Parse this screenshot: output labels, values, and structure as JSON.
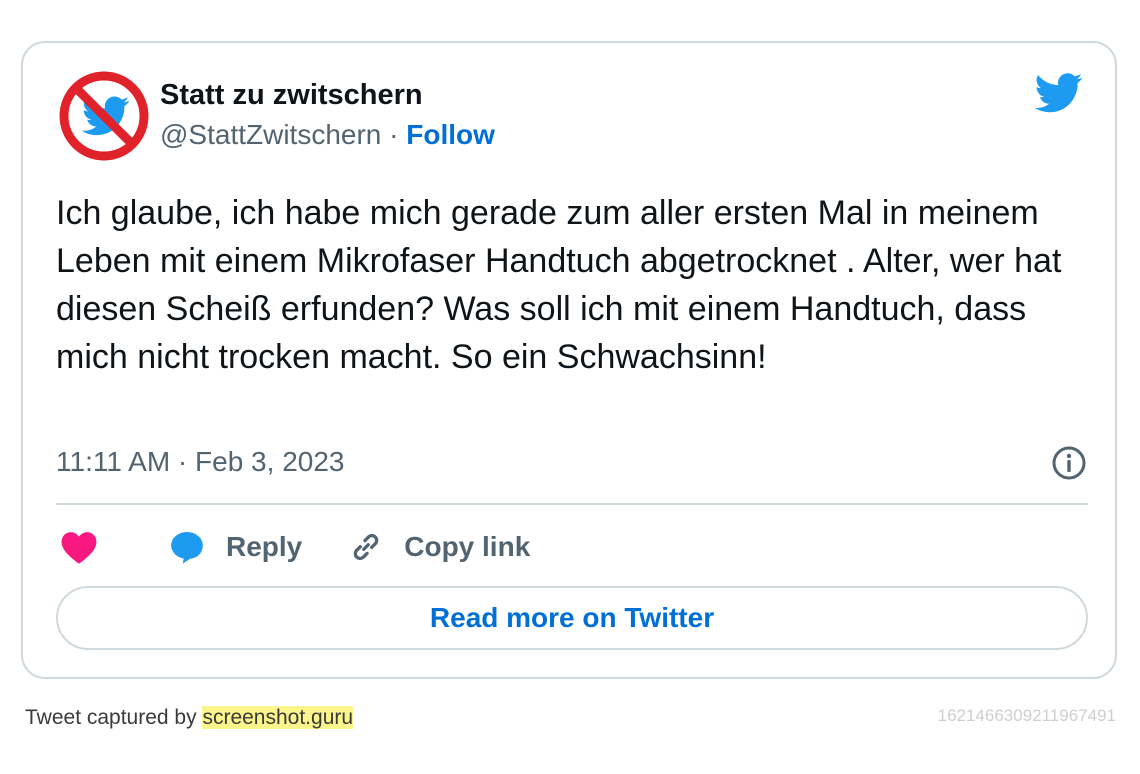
{
  "author": {
    "name": "Statt zu zwitschern",
    "handle": "@StattZwitschern",
    "separator": "·",
    "follow_label": "Follow"
  },
  "tweet": {
    "text": "Ich glaube, ich habe mich gerade zum aller ersten Mal in meinem Leben mit einem Mikrofaser Handtuch abgetrocknet . Alter, wer hat diesen Scheiß erfunden? Was soll ich mit einem Handtuch, dass mich nicht trocken macht. So ein Schwachsinn!",
    "timestamp": "11:11 AM · Feb 3, 2023"
  },
  "actions": {
    "reply_label": "Reply",
    "copy_link_label": "Copy link"
  },
  "read_more_label": "Read more on Twitter",
  "footer": {
    "captured_by": "Tweet captured by",
    "site": "screenshot.guru",
    "tweet_id": "1621466309211967491"
  },
  "colors": {
    "accent": "#006fd6",
    "twitter_blue": "#1d9bf0",
    "heart": "#f91880",
    "no_sign_red": "#e0232b",
    "highlight": "#fbf58c"
  }
}
